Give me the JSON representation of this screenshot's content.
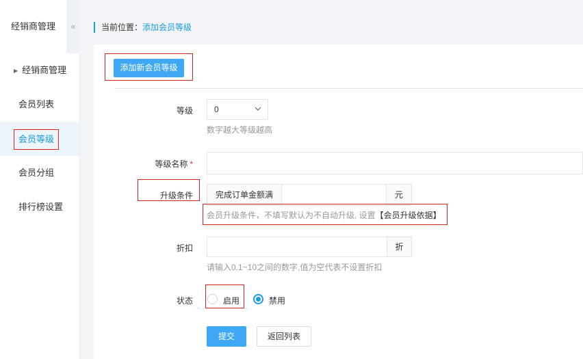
{
  "sidebar": {
    "title": "经销商管理",
    "collapse_icon": "«",
    "group_label": "经销商管理",
    "group_icon": "▶",
    "items": [
      {
        "label": "会员列表"
      },
      {
        "label": "会员等级"
      },
      {
        "label": "会员分组"
      },
      {
        "label": "排行榜设置"
      }
    ]
  },
  "breadcrumb": {
    "prefix": "当前位置：",
    "current": "添加会员等级"
  },
  "toolbar": {
    "add_label": "添加新会员等级"
  },
  "form": {
    "level": {
      "label": "等级",
      "value": "0",
      "hint": "数字越大等级越高"
    },
    "name": {
      "label": "等级名称",
      "required_mark": "*",
      "value": ""
    },
    "upgrade": {
      "label": "升级条件",
      "prefix": "完成订单金额满",
      "value": "",
      "suffix": "元",
      "hint": "会员升级条件，不填写默认为不自动升级, 设置",
      "hint_link": "【会员升级依据】"
    },
    "discount": {
      "label": "折扣",
      "value": "",
      "suffix": "折",
      "hint": "请输入0.1~10之间的数字,值为空代表不设置折扣"
    },
    "status": {
      "label": "状态",
      "options": [
        "启用",
        "禁用"
      ],
      "selected": "禁用"
    }
  },
  "actions": {
    "submit_label": "提交",
    "back_label": "返回列表"
  },
  "colors": {
    "accent": "#1a9ae0",
    "primary_button": "#3ea8f5",
    "highlight_border": "#d9241e",
    "required": "#e33333"
  }
}
